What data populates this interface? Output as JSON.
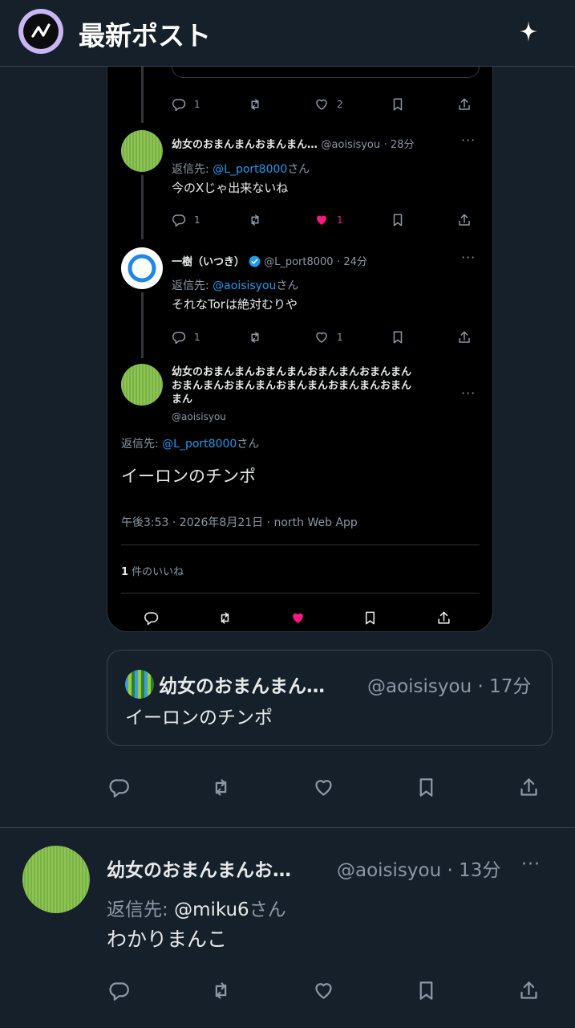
{
  "header": {
    "title": "最新ポスト",
    "logo_icon": "north-logo-icon",
    "sparkle_icon": "sparkle-icon"
  },
  "thread": {
    "top_actions": {
      "replies": "1",
      "likes": "2"
    },
    "reply1": {
      "name": "幼女のおまんまんおまんまん…",
      "handle": "@aoisisyou",
      "time": "· 28分",
      "reply_to_label": "返信先: ",
      "reply_to": "@L_port8000",
      "reply_to_suffix": "さん",
      "text": "今のXじゃ出来ないね",
      "replies": "1",
      "likes": "1"
    },
    "reply2": {
      "name": "一樹（いつき）",
      "handle": "@L_port8000",
      "time": "· 24分",
      "reply_to_label": "返信先: ",
      "reply_to": "@aoisisyou",
      "reply_to_suffix": "さん",
      "text": "それなTorは絶対むりや",
      "replies": "1",
      "likes": "1"
    },
    "main": {
      "name_line1": "幼女のおまんまんおまんまんおまんまんおまんまん",
      "name_line2": "おまんまんおまんまんおまんまんおまんまんおまん",
      "name_line3": "まん",
      "handle": "@aoisisyou",
      "reply_to_label": "返信先: ",
      "reply_to": "@L_port8000",
      "reply_to_suffix": "さん",
      "text": "イーロンのチンポ",
      "timestamp": "午後3:53 · 2026年8月21日 · north Web App",
      "likes_count": "1",
      "likes_label": " 件のいいね"
    }
  },
  "quote": {
    "name": "幼女のおまんまん…",
    "handle": "@aoisisyou · 17分",
    "text": "イーロンのチンポ"
  },
  "post": {
    "name": "幼女のおまんまんお…",
    "handle": "@aoisisyou · 13分",
    "reply_to_label": "返信先: ",
    "reply_to": "@miku6",
    "reply_to_suffix": "さん",
    "text": "わかりまんこ"
  },
  "colors": {
    "bg": "#15202b",
    "card": "#000000",
    "link": "#1d9bf0",
    "like": "#f91880",
    "verified": "#1d9bf0"
  }
}
